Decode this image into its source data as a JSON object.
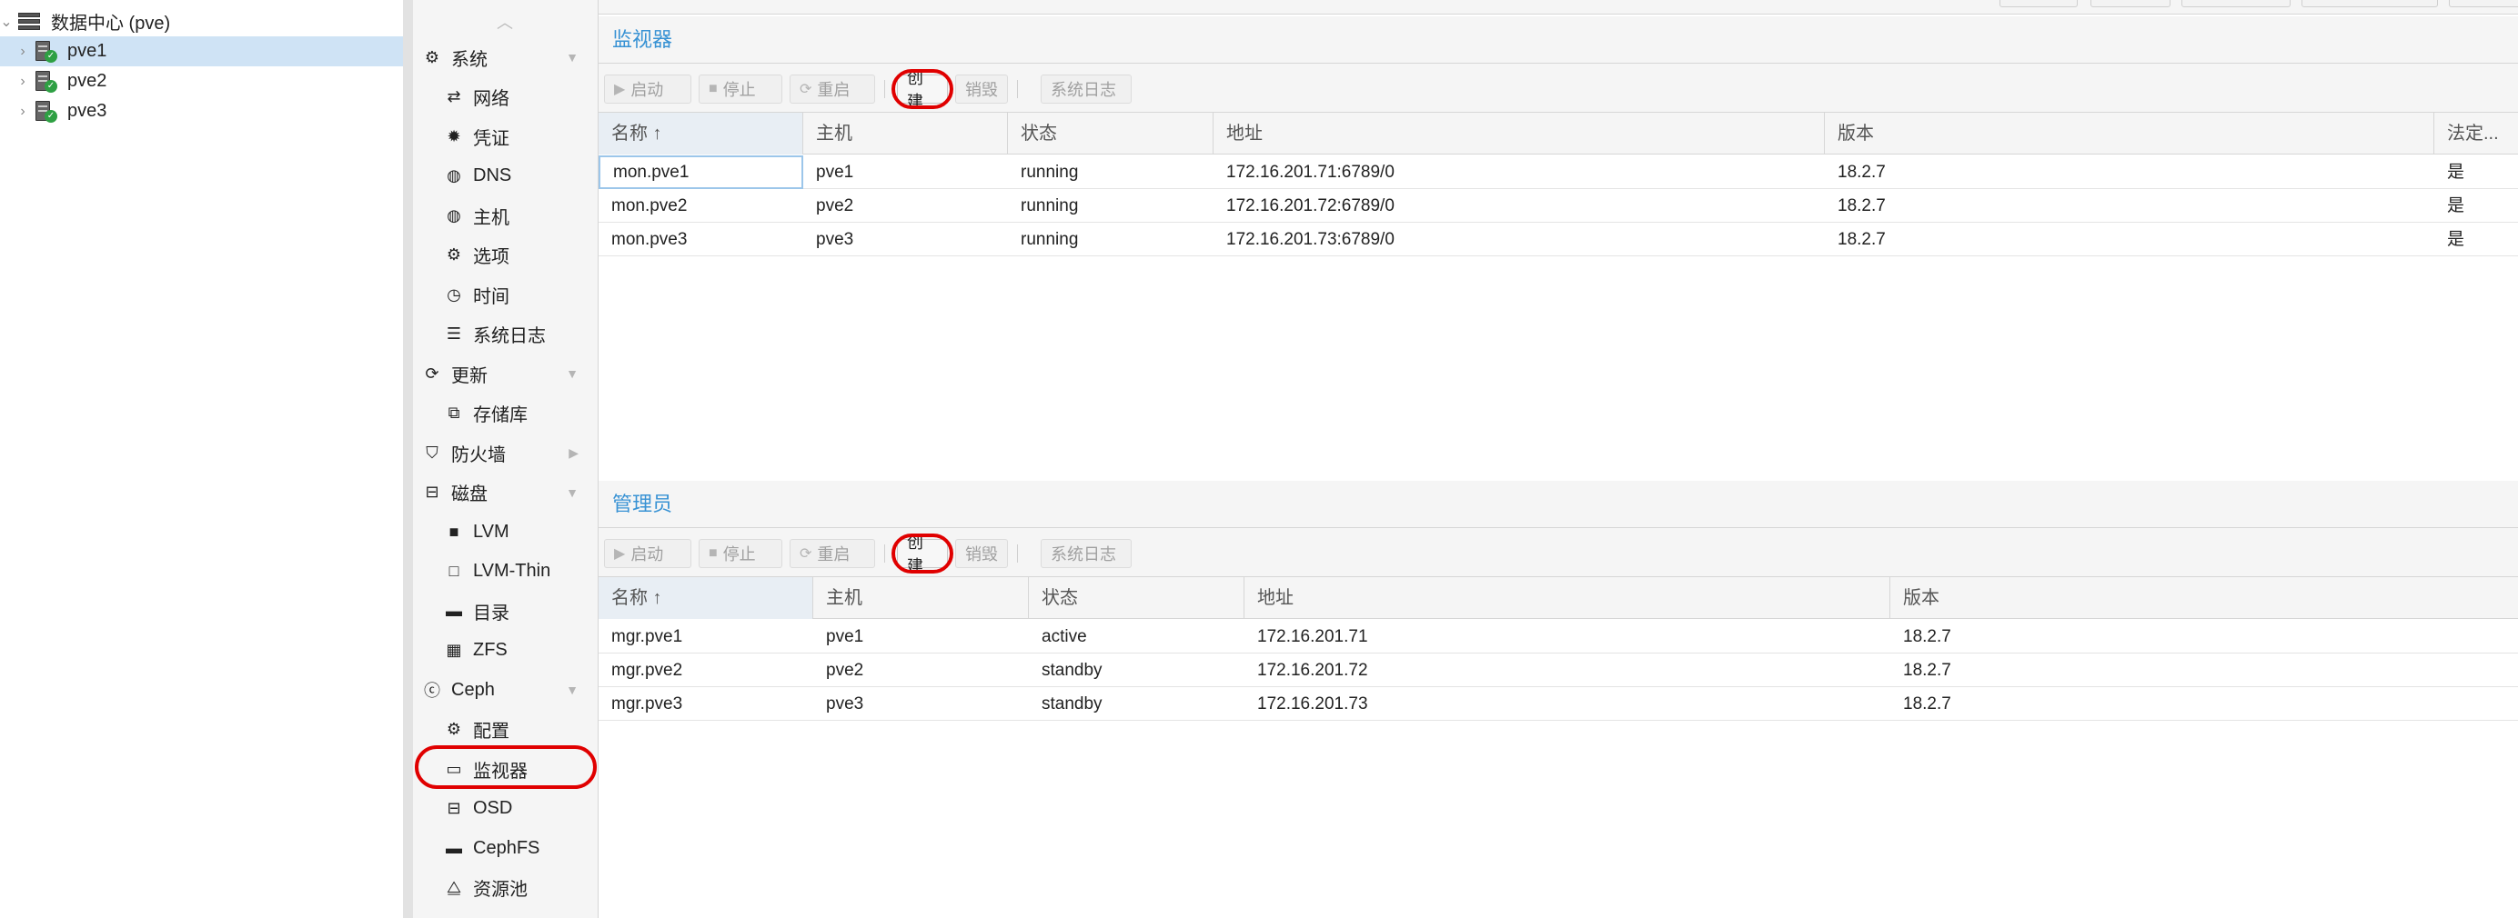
{
  "tree": {
    "datacenter": "数据中心 (pve)",
    "nodes": [
      {
        "name": "pve1",
        "selected": true
      },
      {
        "name": "pve2",
        "selected": false
      },
      {
        "name": "pve3",
        "selected": false
      }
    ]
  },
  "nav": {
    "items": [
      {
        "key": "system",
        "label": "系统",
        "icon": "gears-icon",
        "glyph": "⚙",
        "level": 1,
        "caret": "down"
      },
      {
        "key": "network",
        "label": "网络",
        "icon": "exchange-icon",
        "glyph": "⇄",
        "level": 2
      },
      {
        "key": "certificates",
        "label": "凭证",
        "icon": "certificate-icon",
        "glyph": "✹",
        "level": 2
      },
      {
        "key": "dns",
        "label": "DNS",
        "icon": "globe-icon",
        "glyph": "◍",
        "level": 2
      },
      {
        "key": "hosts",
        "label": "主机",
        "icon": "globe-icon",
        "glyph": "◍",
        "level": 2
      },
      {
        "key": "options",
        "label": "选项",
        "icon": "gear-icon",
        "glyph": "⚙",
        "level": 2
      },
      {
        "key": "time",
        "label": "时间",
        "icon": "clock-icon",
        "glyph": "◷",
        "level": 2
      },
      {
        "key": "syslog",
        "label": "系统日志",
        "icon": "list-icon",
        "glyph": "☰",
        "level": 2
      },
      {
        "key": "updates",
        "label": "更新",
        "icon": "refresh-icon",
        "glyph": "⟳",
        "level": 1,
        "caret": "down"
      },
      {
        "key": "repositories",
        "label": "存储库",
        "icon": "files-icon",
        "glyph": "⧉",
        "level": 2
      },
      {
        "key": "firewall",
        "label": "防火墙",
        "icon": "shield-icon",
        "glyph": "⛉",
        "level": 1,
        "caret": "right"
      },
      {
        "key": "disks",
        "label": "磁盘",
        "icon": "hdd-icon",
        "glyph": "⊟",
        "level": 1,
        "caret": "down"
      },
      {
        "key": "lvm",
        "label": "LVM",
        "icon": "square-icon",
        "glyph": "■",
        "level": 2
      },
      {
        "key": "lvmthin",
        "label": "LVM-Thin",
        "icon": "square-outline-icon",
        "glyph": "□",
        "level": 2
      },
      {
        "key": "directory",
        "label": "目录",
        "icon": "folder-icon",
        "glyph": "▬",
        "level": 2
      },
      {
        "key": "zfs",
        "label": "ZFS",
        "icon": "th-large-icon",
        "glyph": "▦",
        "level": 2
      },
      {
        "key": "ceph",
        "label": "Ceph",
        "icon": "ceph-icon",
        "glyph": "ⓒ",
        "level": 1,
        "caret": "down"
      },
      {
        "key": "config",
        "label": "配置",
        "icon": "gear-icon",
        "glyph": "⚙",
        "level": 2
      },
      {
        "key": "monitor",
        "label": "监视器",
        "icon": "desktop-icon",
        "glyph": "▭",
        "level": 2,
        "active": true
      },
      {
        "key": "osd",
        "label": "OSD",
        "icon": "hdd-icon",
        "glyph": "⊟",
        "level": 2
      },
      {
        "key": "cephfs",
        "label": "CephFS",
        "icon": "folder-icon",
        "glyph": "▬",
        "level": 2
      },
      {
        "key": "pools",
        "label": "资源池",
        "icon": "sitemap-icon",
        "glyph": "⧋",
        "level": 2
      }
    ]
  },
  "monitors": {
    "title": "监视器",
    "toolbar": {
      "start": "启动",
      "stop": "停止",
      "restart": "重启",
      "create": "创建",
      "destroy": "销毁",
      "syslog": "系统日志"
    },
    "columns": [
      "名称 ↑",
      "主机",
      "状态",
      "地址",
      "版本",
      "法定..."
    ],
    "rows": [
      [
        "mon.pve1",
        "pve1",
        "running",
        "172.16.201.71:6789/0",
        "18.2.7",
        "是"
      ],
      [
        "mon.pve2",
        "pve2",
        "running",
        "172.16.201.72:6789/0",
        "18.2.7",
        "是"
      ],
      [
        "mon.pve3",
        "pve3",
        "running",
        "172.16.201.73:6789/0",
        "18.2.7",
        "是"
      ]
    ]
  },
  "managers": {
    "title": "管理员",
    "toolbar": {
      "start": "启动",
      "stop": "停止",
      "restart": "重启",
      "create": "创建",
      "destroy": "销毁",
      "syslog": "系统日志"
    },
    "columns": [
      "名称 ↑",
      "主机",
      "状态",
      "地址",
      "版本"
    ],
    "rows": [
      [
        "mgr.pve1",
        "pve1",
        "active",
        "172.16.201.71",
        "18.2.7"
      ],
      [
        "mgr.pve2",
        "pve2",
        "standby",
        "172.16.201.72",
        "18.2.7"
      ],
      [
        "mgr.pve3",
        "pve3",
        "standby",
        "172.16.201.73",
        "18.2.7"
      ]
    ]
  },
  "colors": {
    "accent": "#3892d4",
    "highlight_ring": "#e00000",
    "selected_row": "#cfe3f5",
    "status_ok": "#2ea043"
  }
}
